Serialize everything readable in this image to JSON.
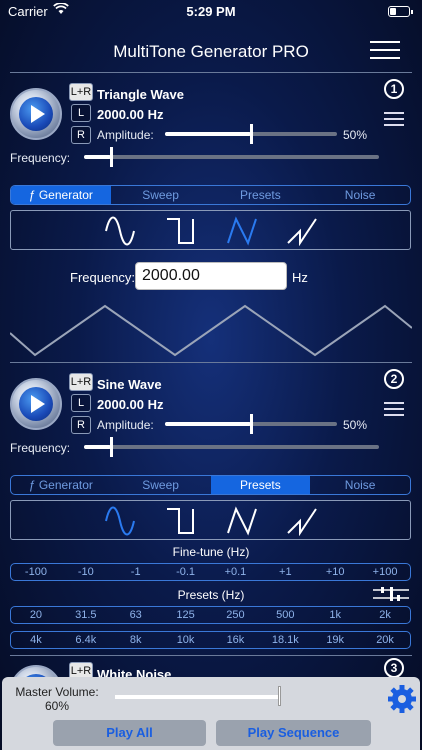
{
  "status": {
    "carrier": "Carrier",
    "time": "5:29 PM"
  },
  "nav": {
    "title": "MultiTone Generator PRO"
  },
  "gen1": {
    "badge": "1",
    "wave_name": "Triangle Wave",
    "freq_display": "2000.00 Hz",
    "lr": "L+R",
    "l": "L",
    "r": "R",
    "amplitude_label": "Amplitude:",
    "amplitude_value": "50%",
    "frequency_label": "Frequency:",
    "tabs": [
      "ƒ Generator",
      "Sweep",
      "Presets",
      "Noise"
    ],
    "active_tab": 0,
    "freq_input_label": "Frequency:",
    "freq_input_value": "2000.00",
    "hz": "Hz"
  },
  "gen2": {
    "badge": "2",
    "wave_name": "Sine Wave",
    "freq_display": "2000.00 Hz",
    "lr": "L+R",
    "l": "L",
    "r": "R",
    "amplitude_label": "Amplitude:",
    "amplitude_value": "50%",
    "frequency_label": "Frequency:",
    "tabs": [
      "ƒ Generator",
      "Sweep",
      "Presets",
      "Noise"
    ],
    "active_tab": 2,
    "finetune_label": "Fine-tune (Hz)",
    "finetune": [
      "-100",
      "-10",
      "-1",
      "-0.1",
      "+0.1",
      "+1",
      "+10",
      "+100"
    ],
    "presets_label": "Presets (Hz)",
    "presets_row1": [
      "20",
      "31.5",
      "63",
      "125",
      "250",
      "500",
      "1k",
      "2k"
    ],
    "presets_row2": [
      "4k",
      "6.4k",
      "8k",
      "10k",
      "16k",
      "18.1k",
      "19k",
      "20k"
    ]
  },
  "gen3": {
    "badge": "3",
    "lr": "L+R",
    "wave_name": "White Noise"
  },
  "bottom": {
    "master_label": "Master Volume:",
    "master_value": "60%",
    "play_all": "Play All",
    "play_sequence": "Play Sequence"
  },
  "colors": {
    "accent": "#1566e0",
    "wave_selected": "#2a7af0"
  }
}
